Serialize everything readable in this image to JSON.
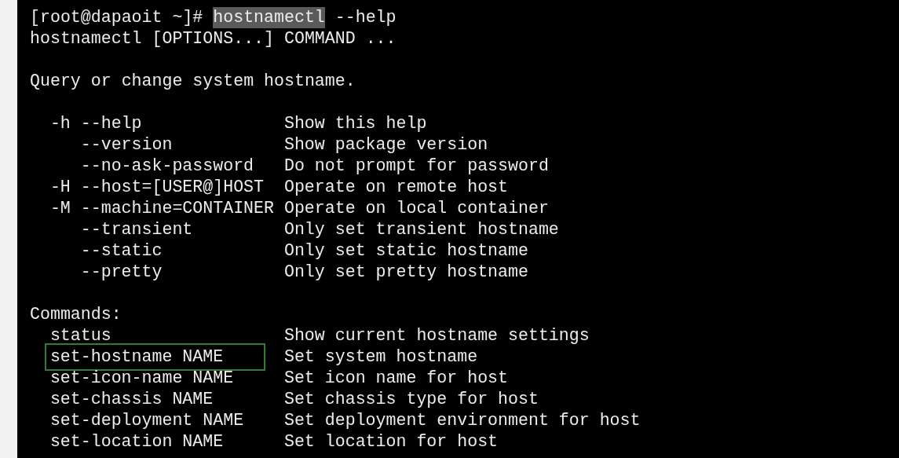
{
  "prompt": {
    "user_host": "[root@dapaoit ~]#",
    "command": "hostnamectl",
    "command_selected": true,
    "args": "--help"
  },
  "usage": "hostnamectl [OPTIONS...] COMMAND ...",
  "description": "Query or change system hostname.",
  "options": [
    {
      "short": "-h",
      "long": "--help",
      "description": "Show this help"
    },
    {
      "long": "--version",
      "description": "Show package version"
    },
    {
      "long": "--no-ask-password",
      "description": "Do not prompt for password"
    },
    {
      "short": "-H",
      "long": "--host=[USER@]HOST",
      "description": "Operate on remote host"
    },
    {
      "short": "-M",
      "long": "--machine=CONTAINER",
      "description": "Operate on local container"
    },
    {
      "long": "--transient",
      "description": "Only set transient hostname"
    },
    {
      "long": "--static",
      "description": "Only set static hostname"
    },
    {
      "long": "--pretty",
      "description": "Only set pretty hostname"
    }
  ],
  "commands_heading": "Commands:",
  "commands": [
    {
      "name": "status",
      "description": "Show current hostname settings",
      "highlighted": false
    },
    {
      "name": "set-hostname NAME",
      "description": "Set system hostname",
      "highlighted": true
    },
    {
      "name": "set-icon-name NAME",
      "description": "Set icon name for host",
      "highlighted": false
    },
    {
      "name": "set-chassis NAME",
      "description": "Set chassis type for host",
      "highlighted": false
    },
    {
      "name": "set-deployment NAME",
      "description": "Set deployment environment for host",
      "highlighted": false
    },
    {
      "name": "set-location NAME",
      "description": "Set location for host",
      "highlighted": false
    }
  ]
}
